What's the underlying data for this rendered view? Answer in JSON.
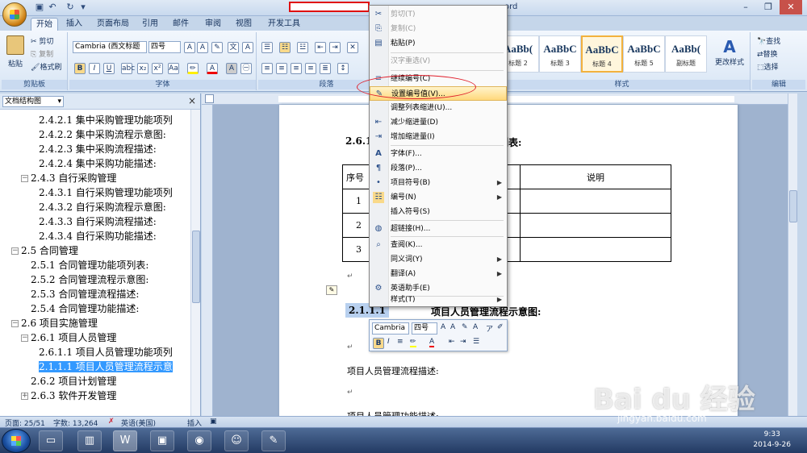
{
  "titlebar": {
    "title_suffix": "ord"
  },
  "ribbon": {
    "tabs": [
      "开始",
      "插入",
      "页面布局",
      "引用",
      "邮件",
      "审阅",
      "视图",
      "开发工具"
    ],
    "clipboard": {
      "paste": "粘贴",
      "cut": "剪切",
      "copy": "复制",
      "format_painter": "格式刷",
      "label": "剪贴板"
    },
    "font": {
      "name": "Cambria (西文标题",
      "size": "四号",
      "label": "字体"
    },
    "paragraph": {
      "label": "段落"
    },
    "styles": {
      "label": "样式",
      "tiles": [
        {
          "preview": "AaBb(",
          "name": "标题 2"
        },
        {
          "preview": "AaBbC",
          "name": "标题 3"
        },
        {
          "preview": "AaBbC",
          "name": "标题 4"
        },
        {
          "preview": "AaBbC",
          "name": "标题 5"
        },
        {
          "preview": "AaBb(",
          "name": "副标题"
        }
      ],
      "change_styles": "更改样式"
    },
    "editing": {
      "find": "查找",
      "replace": "替换",
      "select": "选择",
      "label": "编辑"
    }
  },
  "nav": {
    "mode": "文档结构图",
    "items": [
      "2.4.2.1 集中采购管理功能项列",
      "2.4.2.2 集中采购流程示意图:",
      "2.4.2.3 集中采购流程描述:",
      "2.4.2.4 集中采购功能描述:",
      "2.4.3 自行采购管理",
      "2.4.3.1 自行采购管理功能项列",
      "2.4.3.2 自行采购流程示意图:",
      "2.4.3.3 自行采购流程描述:",
      "2.4.3.4 自行采购功能描述:",
      "2.5 合同管理",
      "2.5.1 合同管理功能项列表:",
      "2.5.2 合同管理流程示意图:",
      "2.5.3 合同管理流程描述:",
      "2.5.4 合同管理功能描述:",
      "2.6 项目实施管理",
      "2.6.1 项目人员管理",
      "2.6.1.1 项目人员管理功能项列",
      "2.1.1.1 项目人员管理流程示意",
      "2.6.2 项目计划管理",
      "2.6.3 软件开发管理"
    ]
  },
  "doc": {
    "heading1_num": "2.6.1",
    "heading1_tail": "列表:",
    "table": {
      "header": [
        "序号",
        "",
        "说明"
      ],
      "rows": [
        [
          "1",
          "",
          ""
        ],
        [
          "2",
          "",
          ""
        ],
        [
          "3",
          "",
          ""
        ]
      ]
    },
    "heading2_num": "2.1.1.1",
    "heading2_text": "项目人员管理流程示意图:",
    "line1": "项目人员管理流程描述:",
    "line2": "项目人员管理功能描述:"
  },
  "context_menu": {
    "items": [
      {
        "label": "剪切(T)",
        "icon": "✂",
        "disabled": true
      },
      {
        "label": "复制(C)",
        "icon": "⎘",
        "disabled": true
      },
      {
        "label": "粘贴(P)",
        "icon": "📋",
        "disabled": false
      },
      {
        "label": "汉字重选(V)",
        "icon": "",
        "disabled": true
      },
      {
        "label": "继续编号(C)",
        "icon": "≡",
        "disabled": false
      },
      {
        "label": "设置编号值(V)...",
        "icon": "✎",
        "disabled": false,
        "highlighted": true
      },
      {
        "label": "调整列表缩进(U)...",
        "icon": "",
        "disabled": false
      },
      {
        "label": "减少缩进量(D)",
        "icon": "⇤",
        "disabled": false
      },
      {
        "label": "增加缩进量(I)",
        "icon": "⇥",
        "disabled": false
      },
      {
        "label": "字体(F)...",
        "icon": "A",
        "disabled": false
      },
      {
        "label": "段落(P)...",
        "icon": "¶",
        "disabled": false
      },
      {
        "label": "项目符号(B)",
        "icon": "•",
        "disabled": false,
        "submenu": true
      },
      {
        "label": "编号(N)",
        "icon": "1.",
        "disabled": false,
        "submenu": true
      },
      {
        "label": "插入符号(S)",
        "icon": "",
        "disabled": false
      },
      {
        "label": "超链接(H)...",
        "icon": "🌐",
        "disabled": false
      },
      {
        "label": "查阅(K)...",
        "icon": "🔍",
        "disabled": false
      },
      {
        "label": "同义词(Y)",
        "icon": "",
        "disabled": false,
        "submenu": true
      },
      {
        "label": "翻译(A)",
        "icon": "",
        "disabled": false,
        "submenu": true
      },
      {
        "label": "英语助手(E)",
        "icon": "⚙",
        "disabled": false
      },
      {
        "label": "样式(T)",
        "icon": "",
        "disabled": false,
        "submenu": true
      }
    ]
  },
  "mini_toolbar": {
    "font": "Cambria",
    "size": "四号"
  },
  "statusbar": {
    "page": "页面: 25/51",
    "words": "字数: 13,264",
    "lang": "英语(美国)",
    "insert": "插入"
  },
  "taskbar": {
    "time": "9:33",
    "date": "2014-9-26"
  },
  "watermark": {
    "brand": "Bai du 经验",
    "url": "jingyan.baidu.com"
  },
  "colors": {
    "highlight_circle": "#e0202c",
    "selection": "#3399ff",
    "menu_highlight": "#ffd87c"
  }
}
